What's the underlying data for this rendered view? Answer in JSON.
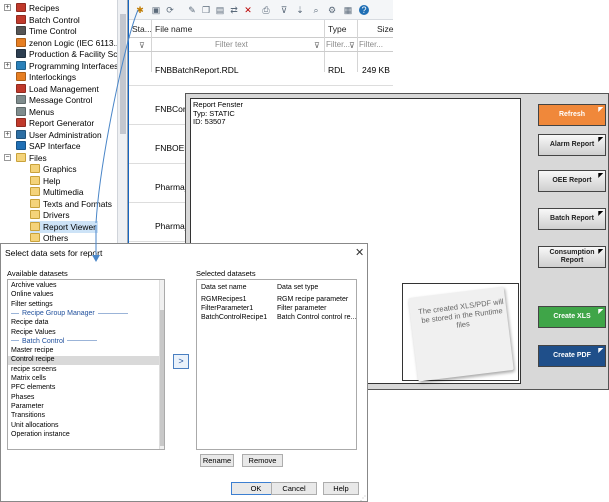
{
  "tree": {
    "items": [
      {
        "label": "Recipes",
        "icon": "recipes-icon",
        "color": "#c0392b",
        "expand": "+",
        "indent": 1
      },
      {
        "label": "Batch Control",
        "icon": "batch-control-icon",
        "color": "#c0392b",
        "expand": "",
        "indent": 1
      },
      {
        "label": "Time Control",
        "icon": "time-control-icon",
        "color": "#555555",
        "expand": "",
        "indent": 1
      },
      {
        "label": "zenon Logic (IEC 6113...",
        "icon": "zenon-logic-icon",
        "color": "#e67e22",
        "expand": "",
        "indent": 1
      },
      {
        "label": "Production & Facility Sch",
        "icon": "production-facility-icon",
        "color": "#2c3e50",
        "expand": "",
        "indent": 1
      },
      {
        "label": "Programming Interfaces",
        "icon": "programming-interfaces-icon",
        "color": "#2980b9",
        "expand": "+",
        "indent": 1
      },
      {
        "label": "Interlockings",
        "icon": "interlockings-icon",
        "color": "#e67e22",
        "expand": "",
        "indent": 1
      },
      {
        "label": "Load Management",
        "icon": "load-management-icon",
        "color": "#c0392b",
        "expand": "",
        "indent": 1
      },
      {
        "label": "Message Control",
        "icon": "message-control-icon",
        "color": "#7f8c8d",
        "expand": "",
        "indent": 1
      },
      {
        "label": "Menus",
        "icon": "menus-icon",
        "color": "#7f8c8d",
        "expand": "",
        "indent": 1
      },
      {
        "label": "Report Generator",
        "icon": "report-generator-icon",
        "color": "#c0392b",
        "expand": "",
        "indent": 1
      },
      {
        "label": "User Administration",
        "icon": "user-administration-icon",
        "color": "#2c6ea3",
        "expand": "+",
        "indent": 1
      },
      {
        "label": "SAP Interface",
        "icon": "sap-interface-icon",
        "color": "#1f6fb5",
        "expand": "",
        "indent": 1
      },
      {
        "label": "Files",
        "icon": "folder-icon",
        "color": "#f4d37a",
        "expand": "−",
        "indent": 1
      },
      {
        "label": "Graphics",
        "icon": "folder-icon",
        "color": "#f4d37a",
        "expand": "",
        "indent": 2
      },
      {
        "label": "Help",
        "icon": "folder-icon",
        "color": "#f4d37a",
        "expand": "",
        "indent": 2
      },
      {
        "label": "Multimedia",
        "icon": "folder-icon",
        "color": "#f4d37a",
        "expand": "",
        "indent": 2
      },
      {
        "label": "Texts and Formats",
        "icon": "folder-icon",
        "color": "#f4d37a",
        "expand": "",
        "indent": 2
      },
      {
        "label": "Drivers",
        "icon": "folder-icon",
        "color": "#f4d37a",
        "expand": "",
        "indent": 2
      },
      {
        "label": "Report Viewer",
        "icon": "folder-icon",
        "color": "#f4d37a",
        "expand": "",
        "indent": 2,
        "selected": true
      },
      {
        "label": "Others",
        "icon": "folder-icon",
        "color": "#f4d37a",
        "expand": "",
        "indent": 2
      }
    ]
  },
  "filelist": {
    "columns": {
      "status": "Sta...",
      "name": "File name",
      "type": "Type",
      "size": "Size"
    },
    "filter": {
      "name_placeholder": "Filter text",
      "type_placeholder": "Filter...",
      "size_placeholder": "Filter..."
    },
    "rows": [
      {
        "name": "FNBBatchReport.RDL",
        "type": "RDL",
        "size": "249 KB"
      },
      {
        "name": "FNBCon",
        "type": "",
        "size": ""
      },
      {
        "name": "FNBOEE",
        "type": "",
        "size": ""
      },
      {
        "name": "Pharma_",
        "type": "",
        "size": ""
      },
      {
        "name": "Pharma_",
        "type": "",
        "size": ""
      }
    ]
  },
  "report": {
    "info_text": "Report Fenster\nTyp: STATIC\nID: 53507",
    "note_text": "The created XLS/PDF will be stored in the Runtime files",
    "buttons": [
      {
        "label": "Refresh",
        "style": "orange"
      },
      {
        "label": "Alarm Report",
        "style": "grey"
      },
      {
        "label": "OEE Report",
        "style": "grey"
      },
      {
        "label": "Batch Report",
        "style": "grey"
      },
      {
        "label": "Consumption Report",
        "style": "grey"
      },
      {
        "label": "Create XLS",
        "style": "green"
      },
      {
        "label": "Create PDF",
        "style": "blue"
      }
    ],
    "colors": {
      "orange": "#f0883a",
      "green": "#3fa548",
      "blue": "#1f4f8a",
      "grey": "#e0e0e0"
    }
  },
  "dialog": {
    "title": "Select data sets for report",
    "available_label": "Available datasets",
    "selected_label": "Selected datasets",
    "available_items": [
      {
        "kind": "item",
        "label": "Archive values"
      },
      {
        "kind": "item",
        "label": "Online values"
      },
      {
        "kind": "item",
        "label": "Filter settings"
      },
      {
        "kind": "group",
        "label": "Recipe Group Manager"
      },
      {
        "kind": "item",
        "label": "Recipe data"
      },
      {
        "kind": "item",
        "label": "Recipe Values"
      },
      {
        "kind": "group",
        "label": "Batch Control"
      },
      {
        "kind": "item",
        "label": "Master recipe"
      },
      {
        "kind": "item",
        "label": "Control recipe",
        "selected": true
      },
      {
        "kind": "item",
        "label": "recipe screens"
      },
      {
        "kind": "item",
        "label": "Matrix cells"
      },
      {
        "kind": "item",
        "label": "PFC elements"
      },
      {
        "kind": "item",
        "label": "Phases"
      },
      {
        "kind": "item",
        "label": "Parameter"
      },
      {
        "kind": "item",
        "label": "Transitions"
      },
      {
        "kind": "item",
        "label": "Unit allocations"
      },
      {
        "kind": "item",
        "label": "Operation instance"
      }
    ],
    "move_label": ">",
    "selected_columns": {
      "name": "Data set name",
      "type": "Data set type"
    },
    "selected_rows": [
      {
        "name": "RGMRecipes1",
        "type": "RGM recipe parameter"
      },
      {
        "name": "FilterParameter1",
        "type": "Filter parameter"
      },
      {
        "name": "BatchControlRecipe1",
        "type": "Batch Control control re..."
      }
    ],
    "rename_label": "Rename",
    "remove_label": "Remove",
    "ok_label": "OK",
    "cancel_label": "Cancel",
    "help_label": "Help",
    "close_label": "✕"
  }
}
